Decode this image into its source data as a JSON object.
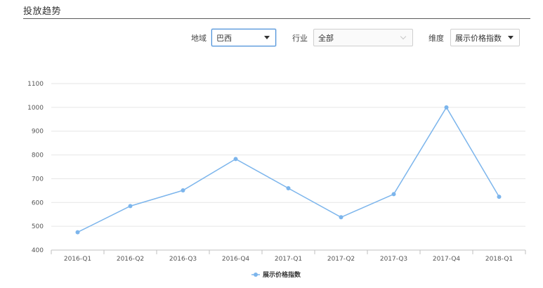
{
  "header": {
    "title": "投放趋势"
  },
  "filters": {
    "region": {
      "label": "地域",
      "value": "巴西"
    },
    "industry": {
      "label": "行业",
      "value": "全部"
    },
    "dimension": {
      "label": "维度",
      "value": "展示价格指数"
    }
  },
  "colors": {
    "series": "#7cb5ec",
    "focus_border": "#4a90d9"
  },
  "chart_data": {
    "type": "line",
    "title": "",
    "xlabel": "",
    "ylabel": "",
    "categories": [
      "2016-Q1",
      "2016-Q2",
      "2016-Q3",
      "2016-Q4",
      "2017-Q1",
      "2017-Q2",
      "2017-Q3",
      "2017-Q4",
      "2018-Q1"
    ],
    "series": [
      {
        "name": "展示价格指数",
        "values": [
          475,
          585,
          651,
          783,
          660,
          538,
          635,
          1000,
          624
        ]
      }
    ],
    "ylim": [
      400,
      1100
    ],
    "yticks": [
      400,
      500,
      600,
      700,
      800,
      900,
      1000,
      1100
    ],
    "grid": true,
    "legend_position": "bottom-center"
  }
}
